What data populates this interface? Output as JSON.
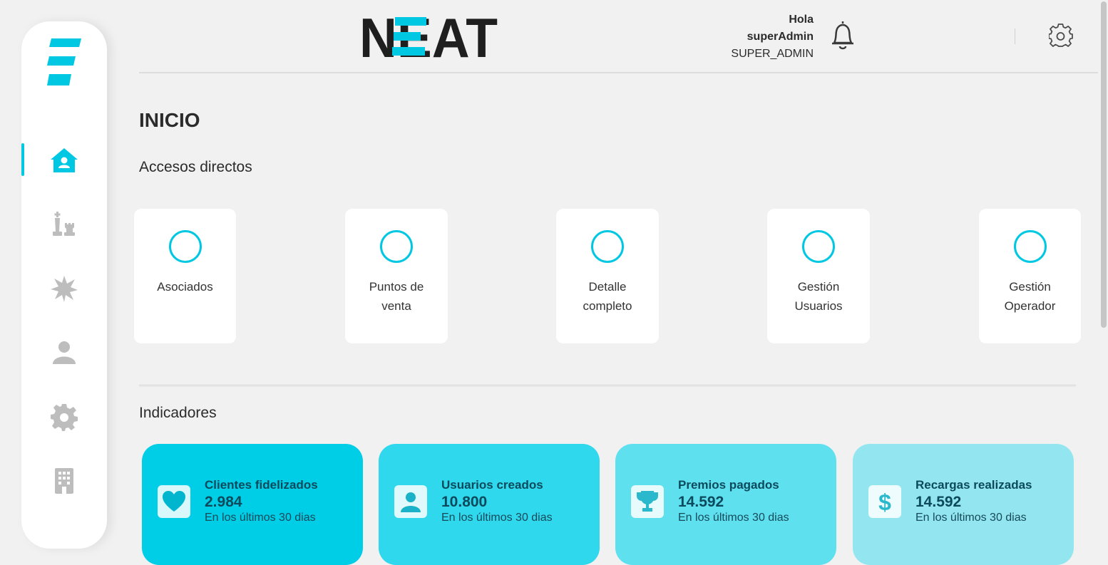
{
  "colors": {
    "accent": "#00c8e3",
    "sidebar_icon": "#bdbdbd",
    "card1": "#00cde6",
    "card2": "#2fd8ec",
    "card3": "#5fe0ef",
    "card4": "#93e6f0"
  },
  "brand": {
    "name": "NEAT"
  },
  "header": {
    "greeting": "Hola",
    "username": "superAdmin",
    "role": "SUPER_ADMIN"
  },
  "sidebar": {
    "items": [
      {
        "icon": "home-icon",
        "active": true
      },
      {
        "icon": "chess-pieces-icon",
        "active": false
      },
      {
        "icon": "starburst-icon",
        "active": false
      },
      {
        "icon": "user-icon",
        "active": false
      },
      {
        "icon": "gear-icon",
        "active": false
      },
      {
        "icon": "building-icon",
        "active": false
      }
    ]
  },
  "page": {
    "title": "INICIO"
  },
  "shortcuts": {
    "title": "Accesos directos",
    "items": [
      {
        "label1": "Asociados",
        "label2": ""
      },
      {
        "label1": "Puntos de",
        "label2": "venta"
      },
      {
        "label1": "Detalle",
        "label2": "completo"
      },
      {
        "label1": "Gestión",
        "label2": "Usuarios"
      },
      {
        "label1": "Gestión",
        "label2": "Operador"
      }
    ]
  },
  "indicators": {
    "title": "Indicadores",
    "items": [
      {
        "icon": "heart-icon",
        "title": "Clientes fidelizados",
        "value": "2.984",
        "subtitle": "En los últimos 30 dias"
      },
      {
        "icon": "user-icon",
        "title": "Usuarios creados",
        "value": "10.800",
        "subtitle": "En los últimos 30 dias"
      },
      {
        "icon": "trophy-icon",
        "title": "Premios pagados",
        "value": "14.592",
        "subtitle": "En los últimos 30 dias"
      },
      {
        "icon": "dollar-icon",
        "title": "Recargas realizadas",
        "value": "14.592",
        "subtitle": "En los últimos 30 dias"
      }
    ]
  }
}
